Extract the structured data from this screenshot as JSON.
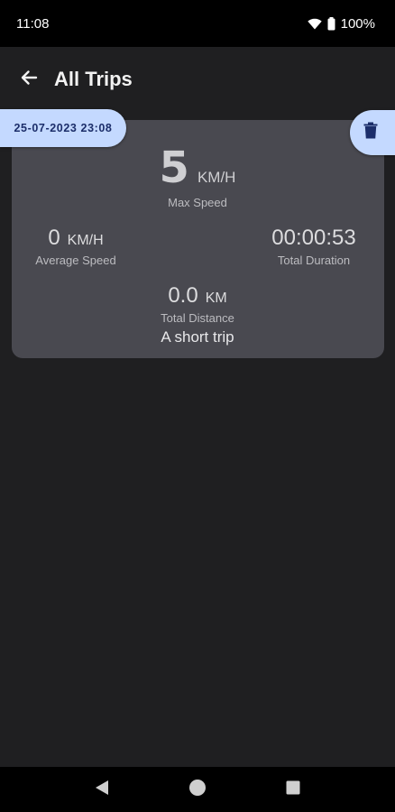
{
  "status_bar": {
    "time": "11:08",
    "battery": "100%",
    "icons": [
      "wifi-icon",
      "battery-icon"
    ]
  },
  "app_bar": {
    "title": "All Trips",
    "back_icon": "arrow-back-icon"
  },
  "trips": [
    {
      "date": "25-07-2023 23:08",
      "max_speed": {
        "value": "5",
        "unit": "KM/H",
        "label": "Max Speed"
      },
      "average_speed": {
        "value": "0",
        "unit": "KM/H",
        "label": "Average Speed"
      },
      "total_duration": {
        "value": "00:00:53",
        "label": "Total Duration"
      },
      "total_distance": {
        "value": "0.0",
        "unit": "KM",
        "label": "Total Distance"
      },
      "name": "A short trip",
      "delete_icon": "trash-icon"
    }
  ],
  "nav_bar": {
    "icons": [
      "back-triangle-icon",
      "home-circle-icon",
      "recents-square-icon"
    ]
  },
  "colors": {
    "background": "#1f1f21",
    "card": "#494950",
    "accent": "#c4d9ff",
    "accent_text": "#1c2e6a"
  }
}
